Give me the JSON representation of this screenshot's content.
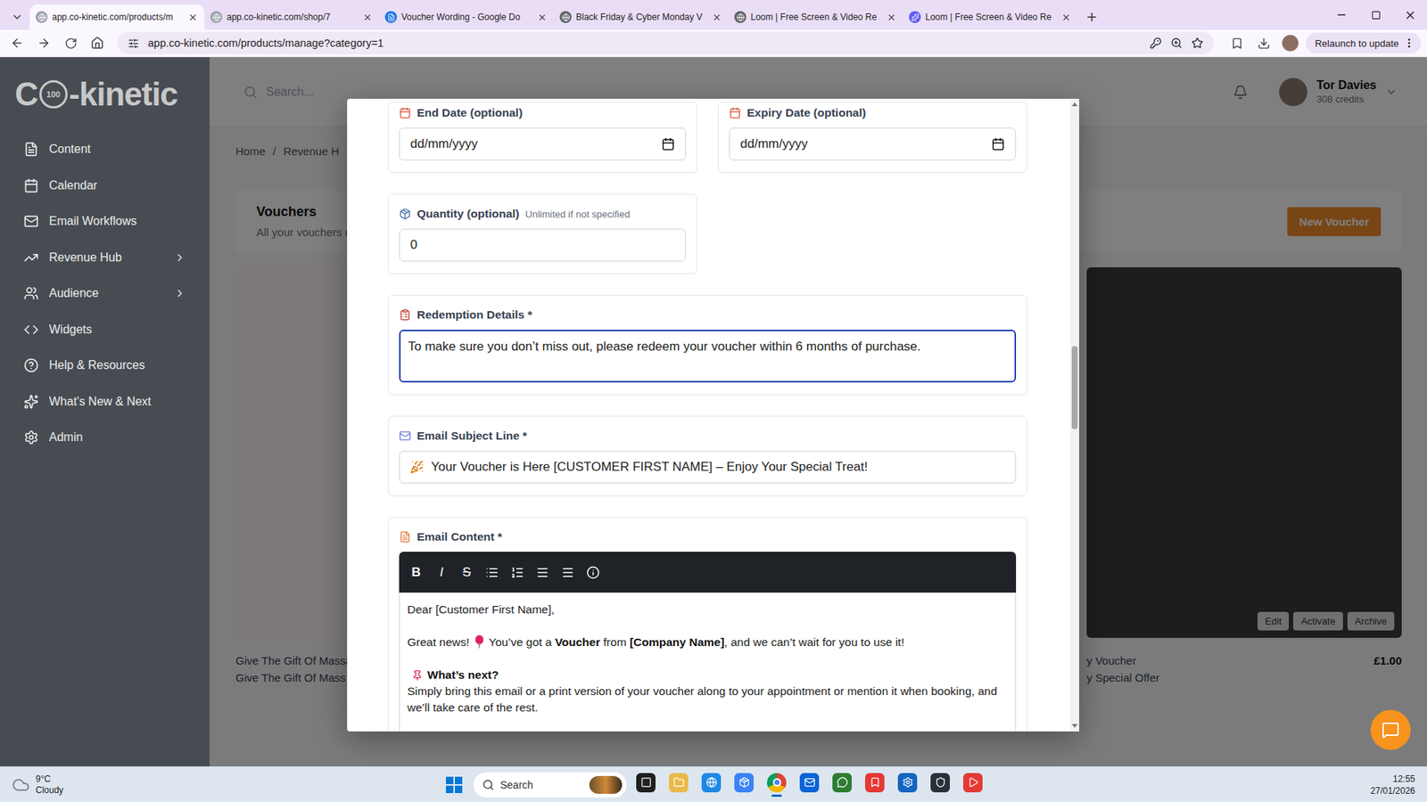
{
  "browser": {
    "tabs": [
      {
        "label": "app.co-kinetic.com/products/m",
        "selected": true
      },
      {
        "label": "app.co-kinetic.com/shop/7",
        "selected": false
      },
      {
        "label": "Voucher Wording - Google Do",
        "selected": false
      },
      {
        "label": "Black Friday & Cyber Monday V",
        "selected": false
      },
      {
        "label": "Loom | Free Screen & Video Re",
        "selected": false
      },
      {
        "label": "Loom | Free Screen & Video Re",
        "selected": false
      }
    ],
    "address": "app.co-kinetic.com/products/manage?category=1",
    "update_button": "Relaunch to update"
  },
  "sidebar": {
    "logo": {
      "prefix": "C",
      "badge": "100",
      "text": "-kinetic"
    },
    "items": [
      {
        "label": "Content",
        "expandable": false
      },
      {
        "label": "Calendar",
        "expandable": false
      },
      {
        "label": "Email Workflows",
        "expandable": false
      },
      {
        "label": "Revenue Hub",
        "expandable": true
      },
      {
        "label": "Audience",
        "expandable": true
      },
      {
        "label": "Widgets",
        "expandable": false
      },
      {
        "label": "Help & Resources",
        "expandable": false
      },
      {
        "label": "What's New & Next",
        "expandable": false
      },
      {
        "label": "Admin",
        "expandable": false
      }
    ]
  },
  "header": {
    "search_placeholder": "Search...",
    "user_name": "Tor Davies",
    "credits": "308 credits"
  },
  "page": {
    "breadcrumb": [
      "Home",
      "Revenue H"
    ],
    "separator": "/",
    "title": "Vouchers",
    "subtitle": "All your vouchers c",
    "new_button": "New Voucher",
    "cards": [
      {
        "tone": "light",
        "lines": [
          "Give The Gift Of Massa",
          "Give The Gift Of Mass"
        ],
        "price": "",
        "actions": []
      },
      {
        "tone": "dark",
        "lines": [
          "y Voucher",
          "y Special Offer"
        ],
        "price": "£1.00",
        "actions": [
          "Edit",
          "Activate",
          "Archive"
        ]
      }
    ]
  },
  "modal": {
    "date_fields": [
      {
        "label": "End Date (optional)",
        "placeholder": "dd/mm/yyyy"
      },
      {
        "label": "Expiry Date (optional)",
        "placeholder": "dd/mm/yyyy"
      }
    ],
    "quantity": {
      "label": "Quantity (optional)",
      "hint": "Unlimited if not specified",
      "value": "0"
    },
    "redemption": {
      "label": "Redemption Details *",
      "value": "To make sure you don’t miss out, please redeem your voucher within 6 months of purchase.",
      "focused": true
    },
    "subject": {
      "label": "Email Subject Line *",
      "value": "Your Voucher is Here [CUSTOMER FIRST NAME] – Enjoy Your Special Treat!"
    },
    "content": {
      "label": "Email Content *",
      "toolbar": [
        "B",
        "I",
        "S"
      ],
      "paragraphs": [
        {
          "kind": "text",
          "parts": [
            {
              "text": "Dear [Customer First Name],",
              "bold": false
            }
          ]
        },
        {
          "kind": "news",
          "lead": "Great news!",
          "parts": [
            {
              "text": "You’ve got a ",
              "bold": false
            },
            {
              "text": "Voucher",
              "bold": true
            },
            {
              "text": " from ",
              "bold": false
            },
            {
              "text": "[Company Name]",
              "bold": true
            },
            {
              "text": ", and we can’t wait for you to use it!",
              "bold": false
            }
          ]
        },
        {
          "kind": "heading",
          "parts": [
            {
              "text": "What’s next?",
              "bold": true
            }
          ]
        },
        {
          "kind": "text",
          "parts": [
            {
              "text": "Simply bring this email or a print version of your voucher along to your appointment or mention it when booking, and we’ll take care of the rest.",
              "bold": false
            }
          ]
        }
      ]
    }
  },
  "taskbar": {
    "temperature": "9°C",
    "weather": "Cloudy",
    "search": "Search",
    "time": "12:55",
    "date": "27/01/2026",
    "apps": [
      {
        "selected": false
      },
      {
        "selected": false
      },
      {
        "selected": false
      },
      {
        "selected": false
      },
      {
        "selected": true
      },
      {
        "selected": false
      },
      {
        "selected": false
      },
      {
        "selected": false
      },
      {
        "selected": false
      },
      {
        "selected": false
      },
      {
        "selected": false
      }
    ]
  }
}
